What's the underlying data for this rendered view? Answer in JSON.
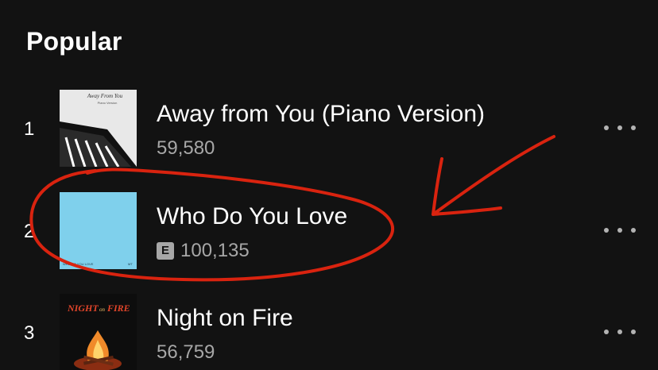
{
  "section": {
    "title": "Popular"
  },
  "tracks": [
    {
      "rank": "1",
      "title": "Away from You (Piano Version)",
      "plays": "59,580",
      "explicit": false,
      "art_text_1": "Away From You",
      "art_text_2": "Piano Version"
    },
    {
      "rank": "2",
      "title": "Who Do You Love",
      "plays": "100,135",
      "explicit": true,
      "explicit_label": "E",
      "art_text_1": "WHO DO YOU LOVE",
      "art_text_2": "MT"
    },
    {
      "rank": "3",
      "title": "Night on Fire",
      "plays": "56,759",
      "explicit": false,
      "art_text_1": "NIGHT",
      "art_text_2": "on",
      "art_text_3": "FIRE"
    }
  ],
  "colors": {
    "background": "#121212",
    "text_primary": "#ffffff",
    "text_secondary": "#a7a7a7",
    "annotation": "#d9230f",
    "art2_background": "#7fd0ec"
  },
  "icons": {
    "more": "more-horizontal-icon"
  }
}
